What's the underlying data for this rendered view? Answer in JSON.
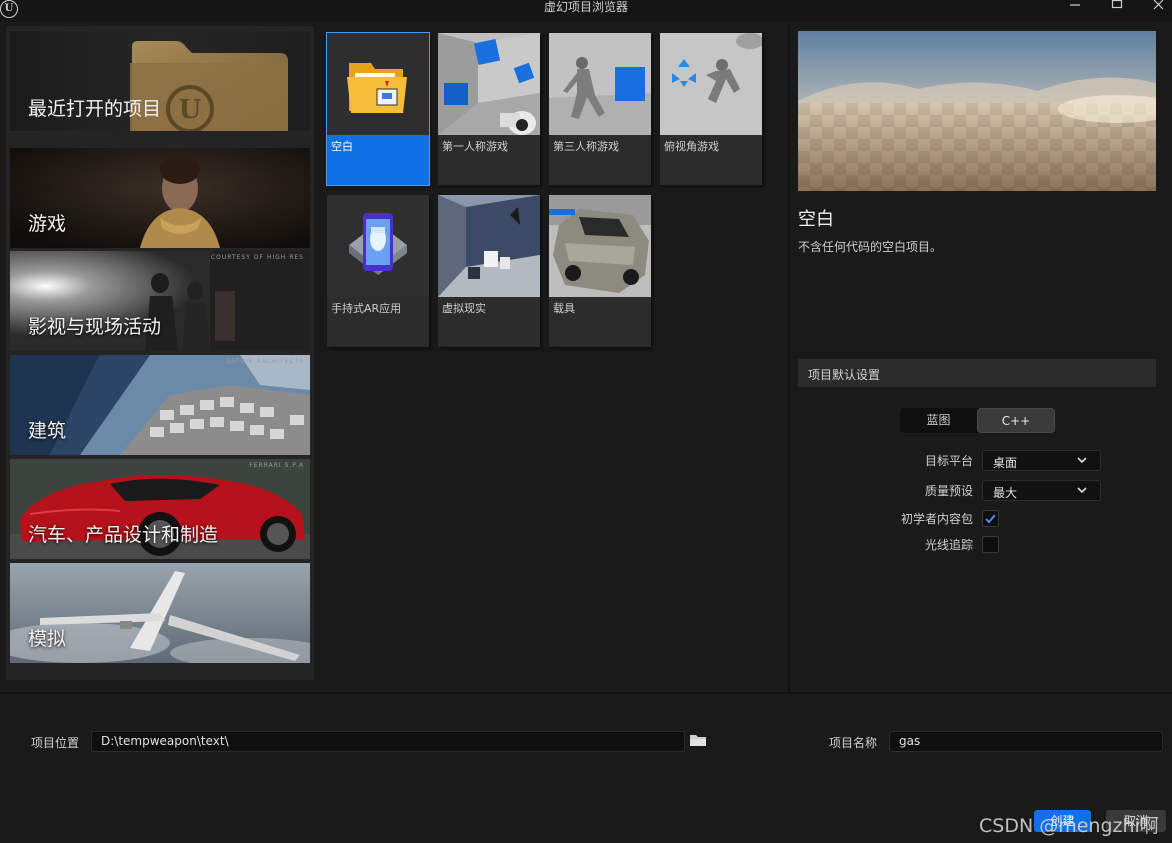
{
  "window": {
    "title": "虚幻项目浏览器",
    "logo_letter": "U"
  },
  "sidebar": {
    "recent_label": "最近打开的项目",
    "categories": [
      {
        "label": "游戏",
        "credit": "",
        "selected": true
      },
      {
        "label": "影视与现场活动",
        "credit": "COURTESY OF HIGH RES"
      },
      {
        "label": "建筑",
        "credit": "SAFDIE ARCHITECTS"
      },
      {
        "label": "汽车、产品设计和制造",
        "credit": "FERRARI S.P.A"
      },
      {
        "label": "模拟",
        "credit": ""
      }
    ]
  },
  "templates": [
    {
      "label": "空白",
      "selected": true
    },
    {
      "label": "第一人称游戏"
    },
    {
      "label": "第三人称游戏"
    },
    {
      "label": "俯视角游戏"
    },
    {
      "label": "手持式AR应用"
    },
    {
      "label": "虚拟现实"
    },
    {
      "label": "载具"
    }
  ],
  "details": {
    "title": "空白",
    "description": "不含任何代码的空白项目。",
    "settings_header": "项目默认设置",
    "mode_options": [
      "蓝图",
      "C++"
    ],
    "mode_selected": "C++",
    "target_platform_label": "目标平台",
    "target_platform_value": "桌面",
    "quality_label": "质量预设",
    "quality_value": "最大",
    "starter_content_label": "初学者内容包",
    "starter_content_checked": true,
    "raytracing_label": "光线追踪",
    "raytracing_checked": false
  },
  "footer": {
    "location_label": "项目位置",
    "location_value": "D:\\tempweapon\\text\\",
    "name_label": "项目名称",
    "name_value": "gas",
    "create_label": "创建",
    "cancel_label": "取消"
  },
  "watermark": "CSDN @mengzhi啊",
  "colors": {
    "accent": "#0e72e6",
    "selection_outline": "#3c7ed6",
    "background": "#1a1a1a",
    "panel": "#242424"
  },
  "icons": [
    "unreal-logo-icon",
    "minimize-icon",
    "maximize-icon",
    "close-icon",
    "folder-icon",
    "chevron-down-icon",
    "check-icon"
  ]
}
